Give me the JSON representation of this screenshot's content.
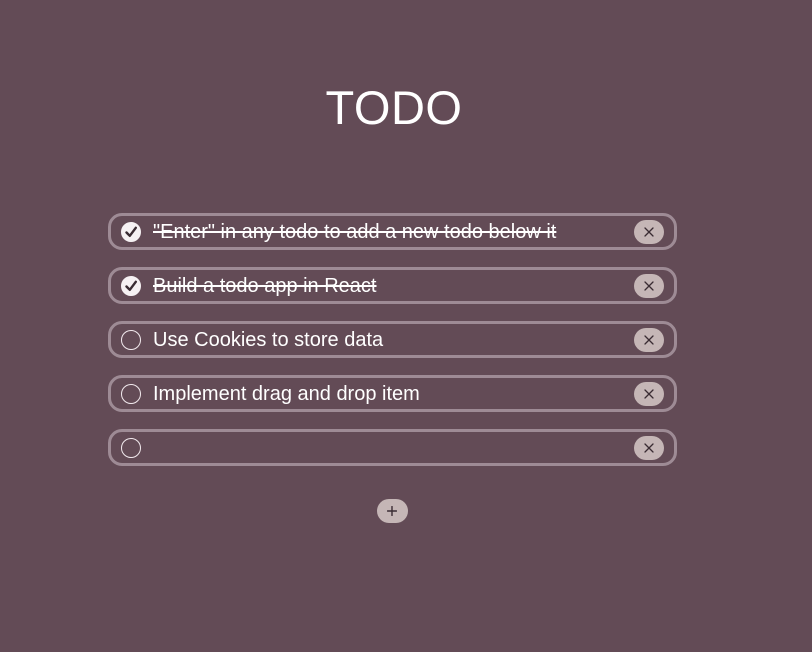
{
  "app": {
    "title": "TODO"
  },
  "todos": [
    {
      "text": "\"Enter\" in any todo to add a new todo below it",
      "completed": true
    },
    {
      "text": "Build a todo app in React",
      "completed": true
    },
    {
      "text": "Use Cookies to store data",
      "completed": false
    },
    {
      "text": "Implement drag and drop item",
      "completed": false
    },
    {
      "text": "",
      "completed": false
    }
  ],
  "icons": {
    "check": "check-icon",
    "delete": "close-icon",
    "add": "plus-icon"
  },
  "colors": {
    "background": "#634b56",
    "row_border": "#9e8b95",
    "button_bg": "#c5b6b6",
    "text": "#ffffff"
  }
}
